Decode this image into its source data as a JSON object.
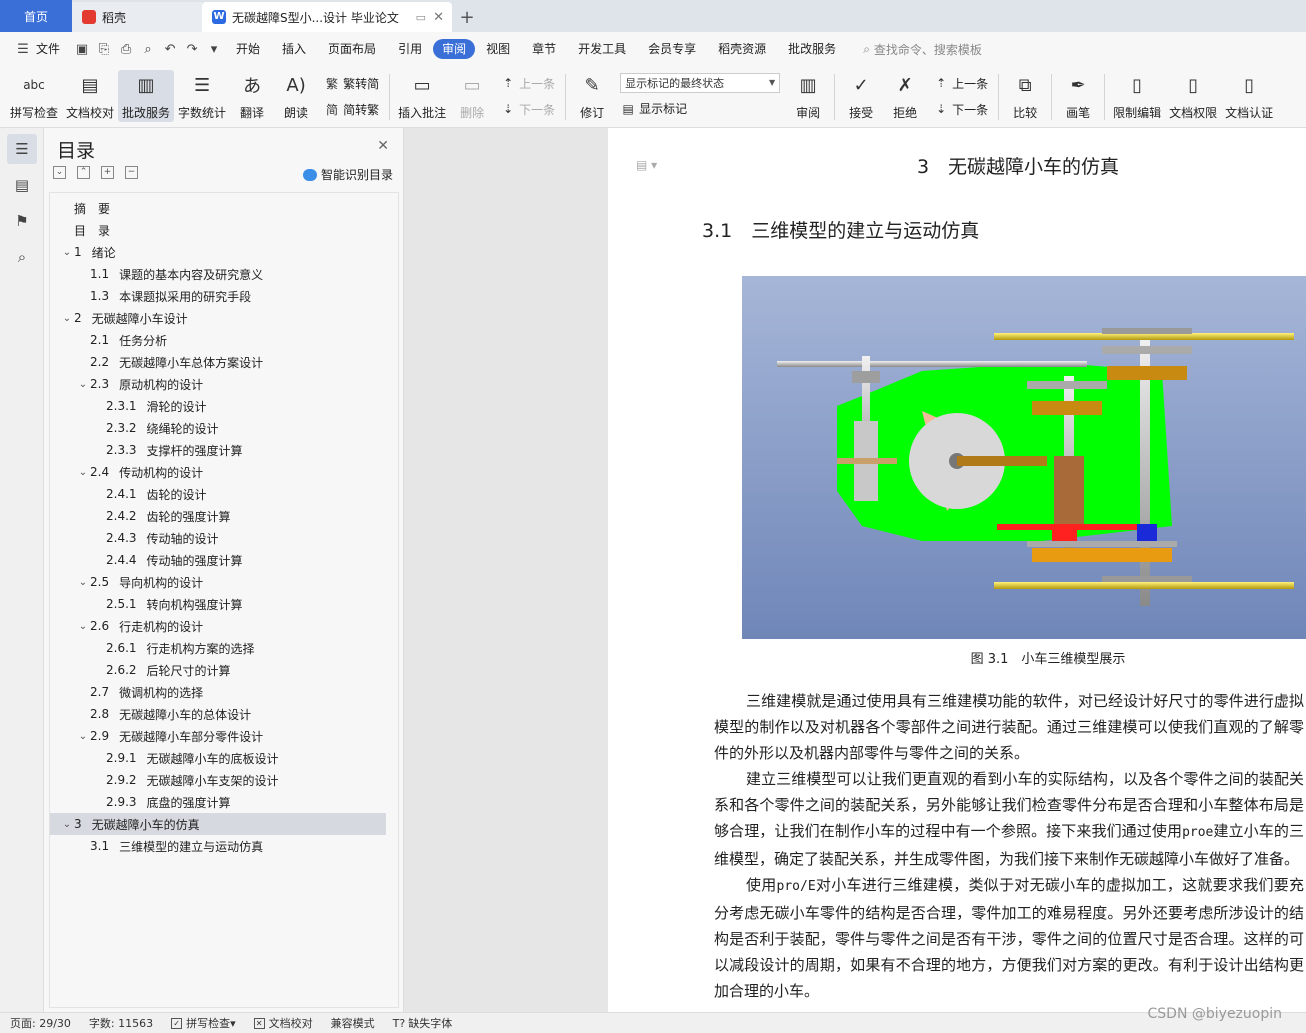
{
  "tabs": {
    "home": "首页",
    "daoke": "稻壳",
    "doc": "无碳越障S型小...设计 毕业论文"
  },
  "menu": [
    "文件",
    "开始",
    "插入",
    "页面布局",
    "引用",
    "审阅",
    "视图",
    "章节",
    "开发工具",
    "会员专享",
    "稻壳资源",
    "批改服务"
  ],
  "menu_active": "审阅",
  "search_cmd": "查找命令、搜索模板",
  "ribbon": {
    "spell": "拼写检查",
    "doc_check": "文档校对",
    "correct": "批改服务",
    "word_count": "字数统计",
    "translate": "翻译",
    "read": "朗读",
    "trad_simp": "繁转简",
    "simp_trad": "简转繁",
    "insert_comment": "插入批注",
    "delete": "删除",
    "prev": "上一条",
    "next": "下一条",
    "revise": "修订",
    "markup_state": "显示标记的最终状态",
    "show_markup": "显示标记",
    "review": "审阅",
    "accept": "接受",
    "reject": "拒绝",
    "prev2": "上一条",
    "next2": "下一条",
    "compare": "比较",
    "pen": "画笔",
    "restrict": "限制编辑",
    "permission": "文档权限",
    "certify": "文档认证"
  },
  "toc": {
    "title": "目录",
    "smart": "智能识别目录",
    "items": [
      {
        "num": "",
        "text": "摘　要",
        "level": 0,
        "arrow": ""
      },
      {
        "num": "",
        "text": "目　录",
        "level": 0,
        "arrow": ""
      },
      {
        "num": "1",
        "text": "绪论",
        "level": 0,
        "arrow": "v"
      },
      {
        "num": "1.1",
        "text": "课题的基本内容及研究意义",
        "level": 1,
        "arrow": ""
      },
      {
        "num": "1.3",
        "text": "本课题拟采用的研究手段",
        "level": 1,
        "arrow": ""
      },
      {
        "num": "2",
        "text": "无碳越障小车设计",
        "level": 0,
        "arrow": "v"
      },
      {
        "num": "2.1",
        "text": "任务分析",
        "level": 1,
        "arrow": ""
      },
      {
        "num": "2.2",
        "text": "无碳越障小车总体方案设计",
        "level": 1,
        "arrow": ""
      },
      {
        "num": "2.3",
        "text": "原动机构的设计",
        "level": 1,
        "arrow": "v"
      },
      {
        "num": "2.3.1",
        "text": "滑轮的设计",
        "level": 2,
        "arrow": ""
      },
      {
        "num": "2.3.2",
        "text": "绕绳轮的设计",
        "level": 2,
        "arrow": ""
      },
      {
        "num": "2.3.3",
        "text": "支撑杆的强度计算",
        "level": 2,
        "arrow": ""
      },
      {
        "num": "2.4",
        "text": "传动机构的设计",
        "level": 1,
        "arrow": "v"
      },
      {
        "num": "2.4.1",
        "text": "齿轮的设计",
        "level": 2,
        "arrow": ""
      },
      {
        "num": "2.4.2",
        "text": "齿轮的强度计算",
        "level": 2,
        "arrow": ""
      },
      {
        "num": "2.4.3",
        "text": "传动轴的设计",
        "level": 2,
        "arrow": ""
      },
      {
        "num": "2.4.4",
        "text": "传动轴的强度计算",
        "level": 2,
        "arrow": ""
      },
      {
        "num": "2.5",
        "text": "导向机构的设计",
        "level": 1,
        "arrow": "v"
      },
      {
        "num": "2.5.1",
        "text": "转向机构强度计算",
        "level": 2,
        "arrow": ""
      },
      {
        "num": "2.6",
        "text": "行走机构的设计",
        "level": 1,
        "arrow": "v"
      },
      {
        "num": "2.6.1",
        "text": "行走机构方案的选择",
        "level": 2,
        "arrow": ""
      },
      {
        "num": "2.6.2",
        "text": "后轮尺寸的计算",
        "level": 2,
        "arrow": ""
      },
      {
        "num": "2.7",
        "text": "微调机构的选择",
        "level": 1,
        "arrow": ""
      },
      {
        "num": "2.8",
        "text": "无碳越障小车的总体设计",
        "level": 1,
        "arrow": ""
      },
      {
        "num": "2.9",
        "text": "无碳越障小车部分零件设计",
        "level": 1,
        "arrow": "v"
      },
      {
        "num": "2.9.1",
        "text": "无碳越障小车的底板设计",
        "level": 2,
        "arrow": ""
      },
      {
        "num": "2.9.2",
        "text": "无碳越障小车支架的设计",
        "level": 2,
        "arrow": ""
      },
      {
        "num": "2.9.3",
        "text": "底盘的强度计算",
        "level": 2,
        "arrow": ""
      },
      {
        "num": "3",
        "text": "无碳越障小车的仿真",
        "level": 0,
        "arrow": "v",
        "selected": true
      },
      {
        "num": "3.1",
        "text": "三维模型的建立与运动仿真",
        "level": 1,
        "arrow": ""
      }
    ]
  },
  "doc": {
    "chapter_num": "3",
    "chapter_title": "无碳越障小车的仿真",
    "section_num": "3.1",
    "section_title": "三维模型的建立与运动仿真",
    "figure_caption": "图 3.1　小车三维模型展示",
    "p1": "三维建模就是通过使用具有三维建模功能的软件，对已经设计好尺寸的零件进行虚拟模型的制作以及对机器各个零部件之间进行装配。通过三维建模可以使我们直观的了解零件的外形以及机器内部零件与零件之间的关系。",
    "p2a": "建立三维模型可以让我们更直观的看到小车的实际结构，以及各个零件之间的装配关系和各个零件之间的装配关系，另外能够让我们检查零件分布是否合理和小车整体布局是够合理，让我们在制作小车的过程中有一个参照。接下来我们通过使用",
    "p2_code": "proe",
    "p2b": "建立小车的三维模型，确定了装配关系，并生成零件图，为我们接下来制作无碳越障小车做好了准备。",
    "p3a": "使用",
    "p3_code": "pro/E",
    "p3b": "对小车进行三维建模，类似于对无碳小车的虚拟加工，这就要求我们要充分考虑无碳小车零件的结构是否合理，零件加工的难易程度。另外还要考虑所涉设计的结构是否利于装配，零件与零件之间是否有干涉，零件之间的位置尺寸是否合理。这样的可以减段设计的周期，如果有不合理的地方，方便我们对方案的更改。有利于设计出结构更加合理的小车。"
  },
  "status": {
    "page": "页面: 29/30",
    "words": "字数: 11563",
    "spell": "拼写检查",
    "doc_check": "文档校对",
    "compat": "兼容模式",
    "missing_font": "缺失字体"
  },
  "watermark": "CSDN @biyezuopin",
  "colors": {
    "accent": "#3b6fd8",
    "model_green": "#00ff00",
    "model_bg_top": "#a6b6d8",
    "model_bg_bottom": "#6f86b8"
  }
}
